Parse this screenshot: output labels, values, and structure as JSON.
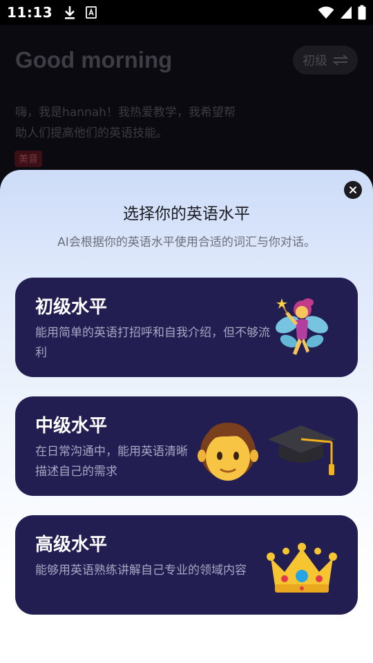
{
  "status_bar": {
    "time": "11:13",
    "left_icons": [
      "download-icon",
      "font-app-icon"
    ],
    "right_icons": [
      "wifi-icon",
      "signal-icon",
      "battery-icon"
    ]
  },
  "background_page": {
    "greeting": "Good morning",
    "level_switch": {
      "label": "初级",
      "icon": "swap-icon"
    },
    "intro": "嗨，我是hannah！我热爱教学，我希望帮助人们提高他们的英语技能。",
    "accent_tag": "美音"
  },
  "sheet": {
    "title": "选择你的英语水平",
    "subtitle": "AI会根据你的英语水平使用合适的词汇与你对话。",
    "close_icon": "close-icon",
    "levels": [
      {
        "title": "初级水平",
        "description": "能用简单的英语打招呼和自我介绍，但不够流利",
        "illustration": "fairy-icon"
      },
      {
        "title": "中级水平",
        "description": "在日常沟通中，能用英语清晰描述自己的需求",
        "illustration": "student-graduation-cap-icon"
      },
      {
        "title": "高级水平",
        "description": "能够用英语熟练讲解自己专业的领域内容",
        "illustration": "crown-icon"
      }
    ]
  },
  "colors": {
    "card_bg": "#221e52",
    "sheet_gradient_top": "#cddcf8",
    "accent_tag_bg": "#3a1016"
  }
}
